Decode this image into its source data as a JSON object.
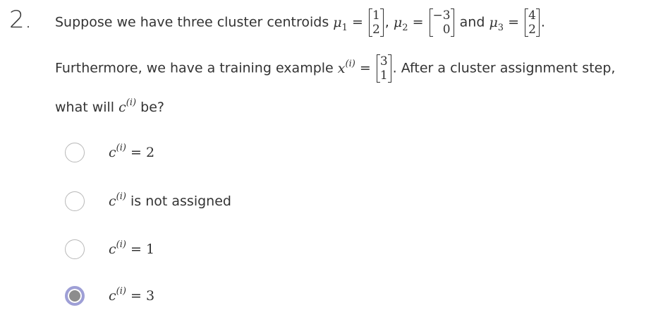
{
  "question": {
    "number": "2.",
    "line1_text": "Suppose we have three cluster centroids ",
    "mu1_name": "μ",
    "mu1_sub": "1",
    "mu1_vec": [
      "1",
      "2"
    ],
    "mu2_name": "μ",
    "mu2_sub": "2",
    "mu2_vec": [
      "−3",
      "0"
    ],
    "and_text": "and",
    "mu3_name": "μ",
    "mu3_sub": "3",
    "mu3_vec": [
      "4",
      "2"
    ],
    "equals": "=",
    "comma": ",",
    "period": ".",
    "line2_text": "Furthermore, we have a training example ",
    "x_name": "x",
    "sup_i": "(i)",
    "x_vec": [
      "3",
      "1"
    ],
    "line2_after": ". After a cluster assignment step,",
    "line3_text": "what will ",
    "c_name": "c",
    "line3_after": " be?"
  },
  "options": [
    {
      "math": "= 2",
      "text": "",
      "selected": false
    },
    {
      "math": "",
      "text": "is not assigned",
      "selected": false
    },
    {
      "math": "= 1",
      "text": "",
      "selected": false
    },
    {
      "math": "= 3",
      "text": "",
      "selected": true
    }
  ],
  "colors": {
    "selected_ring": "#9e9fd6",
    "selected_fill": "#8d8d8d"
  }
}
